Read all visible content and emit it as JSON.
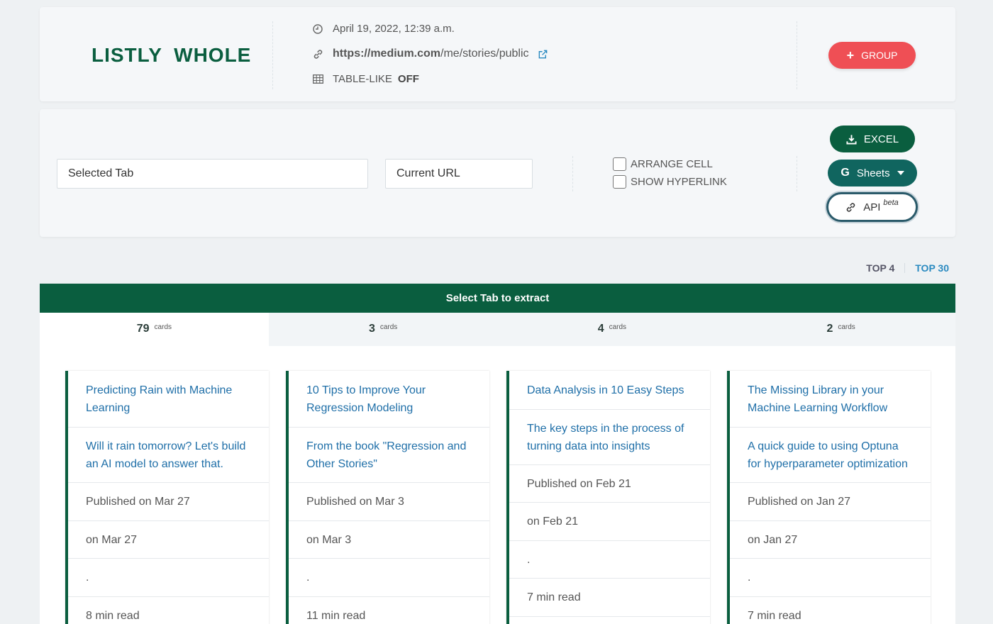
{
  "header": {
    "logo": "LISTLY WHOLE",
    "timestamp": "April 19, 2022, 12:39 a.m.",
    "url_bold": "https://medium.com",
    "url_rest": "/me/stories/public",
    "table_like_label": "TABLE-LIKE",
    "table_like_value": "OFF",
    "group_button": "GROUP"
  },
  "controls": {
    "selected_tab": "Selected Tab",
    "current_url": "Current URL",
    "arrange_cell": "ARRANGE CELL",
    "show_hyperlink": "SHOW HYPERLINK",
    "excel_button": "EXCEL",
    "sheets_button": "Sheets",
    "api_button": "API",
    "api_badge": "beta"
  },
  "top_tabs": {
    "top4": "TOP 4",
    "top30": "TOP 30"
  },
  "select_bar": "Select Tab to extract",
  "tabs": [
    {
      "count": "79",
      "unit": "cards"
    },
    {
      "count": "3",
      "unit": "cards"
    },
    {
      "count": "4",
      "unit": "cards"
    },
    {
      "count": "2",
      "unit": "cards"
    }
  ],
  "cards": [
    {
      "title": "Predicting Rain with Machine Learning",
      "subtitle": "Will it rain tomorrow? Let's build an AI model to answer that.",
      "published": "Published on Mar 27",
      "on": "on Mar 27",
      "dot": ".",
      "read": "8 min read"
    },
    {
      "title": "10 Tips to Improve Your Regression Modeling",
      "subtitle": "From the book \"Regression and Other Stories\"",
      "published": "Published on Mar 3",
      "on": "on Mar 3",
      "dot": ".",
      "read": "11 min read"
    },
    {
      "title": "Data Analysis in 10 Easy Steps",
      "subtitle": "The key steps in the process of turning data into insights",
      "published": "Published on Feb 21",
      "on": "on Feb 21",
      "dot": ".",
      "read": "7 min read"
    },
    {
      "title": "The Missing Library in your Machine Learning Workflow",
      "subtitle": "A quick guide to using Optuna for hyperparameter optimization",
      "published": "Published on Jan 27",
      "on": "on Jan 27",
      "dot": ".",
      "read": "7 min read"
    }
  ],
  "colors": {
    "brand_green": "#0a5e3f",
    "group_red": "#ef4f55",
    "link_blue": "#1f6fa8"
  }
}
